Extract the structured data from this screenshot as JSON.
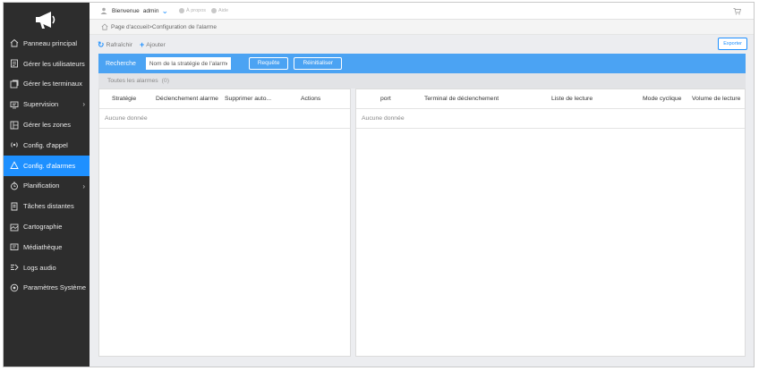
{
  "sidebar": {
    "items": [
      {
        "label": "Panneau principal",
        "icon": "home-icon",
        "active": false,
        "has_submenu": false
      },
      {
        "label": "Gérer les utilisateurs",
        "icon": "user-list-icon",
        "active": false,
        "has_submenu": false
      },
      {
        "label": "Gérer les terminaux",
        "icon": "terminal-icon",
        "active": false,
        "has_submenu": false
      },
      {
        "label": "Supervision",
        "icon": "monitor-icon",
        "active": false,
        "has_submenu": true
      },
      {
        "label": "Gérer les zones",
        "icon": "zone-icon",
        "active": false,
        "has_submenu": false
      },
      {
        "label": "Config. d'appel",
        "icon": "broadcast-icon",
        "active": false,
        "has_submenu": false
      },
      {
        "label": "Config. d'alarmes",
        "icon": "alarm-icon",
        "active": true,
        "has_submenu": false
      },
      {
        "label": "Planification",
        "icon": "clock-icon",
        "active": false,
        "has_submenu": true
      },
      {
        "label": "Tâches distantes",
        "icon": "task-icon",
        "active": false,
        "has_submenu": false
      },
      {
        "label": "Cartographie",
        "icon": "map-icon",
        "active": false,
        "has_submenu": false
      },
      {
        "label": "Médiathèque",
        "icon": "media-icon",
        "active": false,
        "has_submenu": false
      },
      {
        "label": "Logs audio",
        "icon": "log-icon",
        "active": false,
        "has_submenu": false
      },
      {
        "label": "Paramètres Système",
        "icon": "settings-icon",
        "active": false,
        "has_submenu": false
      }
    ],
    "submenu_glyph": "›"
  },
  "header": {
    "welcome": "Bienvenue",
    "username": "admin",
    "dropdown_glyph": "⌄",
    "about": "À propos",
    "help": "Aide"
  },
  "breadcrumb": {
    "text": "Page d'accueil>Configuration de l'alarme"
  },
  "toolbar": {
    "refresh_glyph": "↻",
    "refresh": "Rafraîchir",
    "add_glyph": "+",
    "add": "Ajouter",
    "export": "Exporter"
  },
  "search": {
    "label": "Recherche",
    "placeholder": "Nom de la stratégie de l'alarme",
    "query_button": "Requête",
    "reset_button": "Réinitialiser"
  },
  "tab": {
    "label": "Toutes les alarmes",
    "count": "(0)"
  },
  "left_table": {
    "columns": [
      "Stratégie",
      "Déclenchement alarme",
      "Supprimer auto...",
      "Actions"
    ],
    "empty_text": "Aucune donnée"
  },
  "right_table": {
    "columns": [
      "port",
      "Terminal de déclenchement",
      "Liste de lecture",
      "Mode cyclique",
      "Volume de lecture"
    ],
    "empty_text": "Aucune donnée"
  },
  "colors": {
    "sidebar_bg": "#2d2d2d",
    "accent": "#1e90ff",
    "search_bar_bg": "#4ba3f3",
    "page_bg": "#ecedf0"
  }
}
